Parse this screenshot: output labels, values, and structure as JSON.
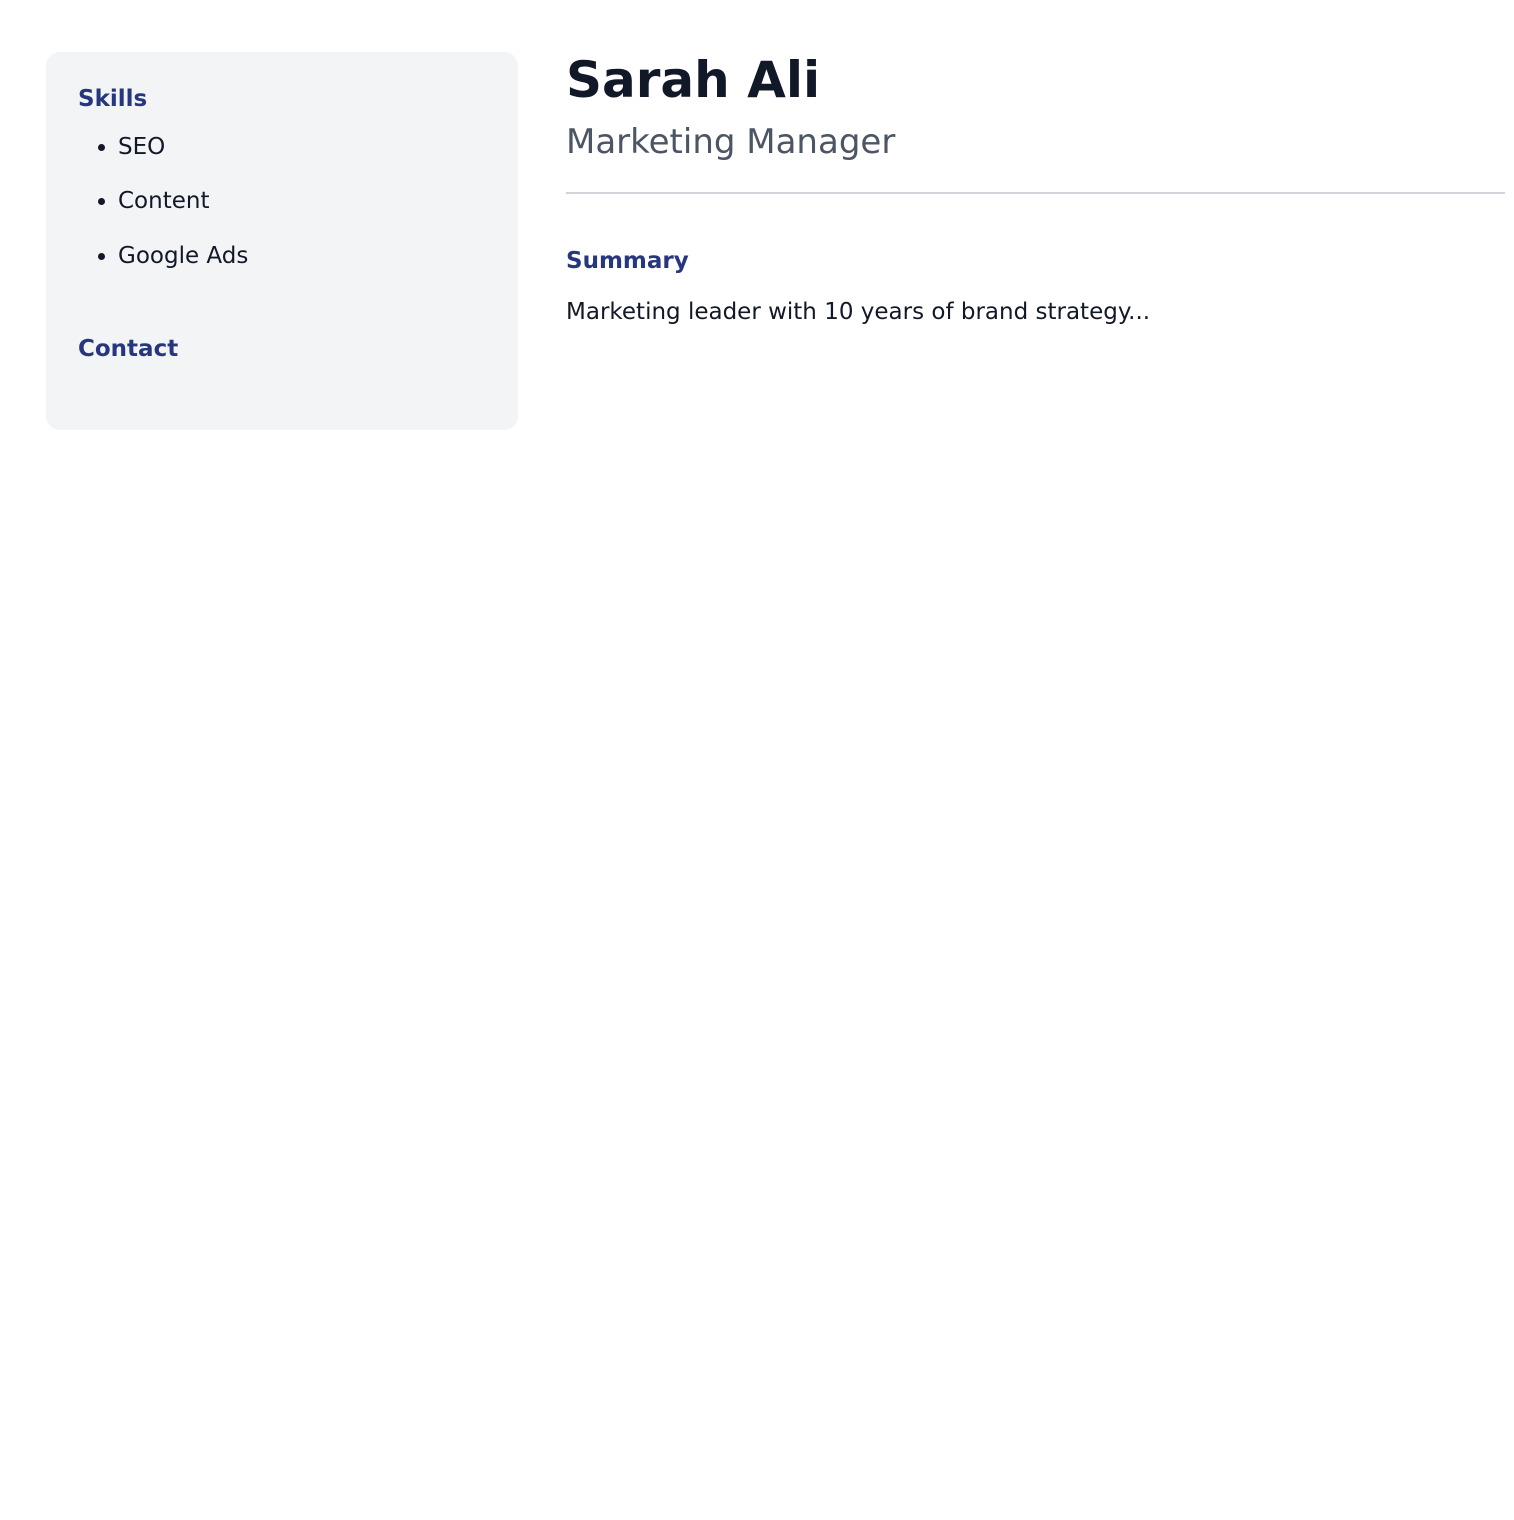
{
  "sidebar": {
    "skills_heading": "Skills",
    "skills": [
      "SEO",
      "Content",
      "Google Ads"
    ],
    "contact_heading": "Contact"
  },
  "header": {
    "name": "Sarah Ali",
    "role": "Marketing Manager"
  },
  "summary": {
    "heading": "Summary",
    "text": "Marketing leader with 10 years of brand strategy..."
  },
  "colors": {
    "accent": "#263780",
    "sidebar_bg": "#f3f4f6",
    "text": "#111827",
    "muted": "#4b5563",
    "divider": "#d1d5db"
  }
}
